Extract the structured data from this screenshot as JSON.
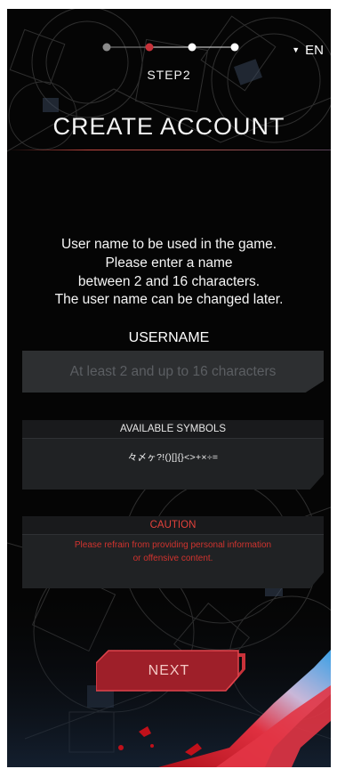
{
  "steps": {
    "current_label": "STEP2",
    "total": 4,
    "current_index": 1
  },
  "language": {
    "selected": "EN",
    "icon": "caret-down-icon"
  },
  "title": "CREATE ACCOUNT",
  "description": {
    "lines": [
      "User name to be used in the game.",
      "Please enter a name",
      "between 2 and 16 characters.",
      "The user name can be changed later."
    ]
  },
  "username": {
    "label": "USERNAME",
    "value": "",
    "placeholder": "At least 2 and up to 16 characters"
  },
  "symbols": {
    "header": "AVAILABLE SYMBOLS",
    "list": "々〆ヶ?!()[]{}<>+×÷="
  },
  "caution": {
    "header": "CAUTION",
    "lines": [
      "Please refrain from providing personal information",
      "or offensive content."
    ]
  },
  "next_button": {
    "label": "NEXT"
  },
  "colors": {
    "accent_red": "#c8323a",
    "step_done": "#8a8a8a",
    "step_current": "#c8323a",
    "step_todo": "#ffffff",
    "caution_text": "#d0332e"
  }
}
